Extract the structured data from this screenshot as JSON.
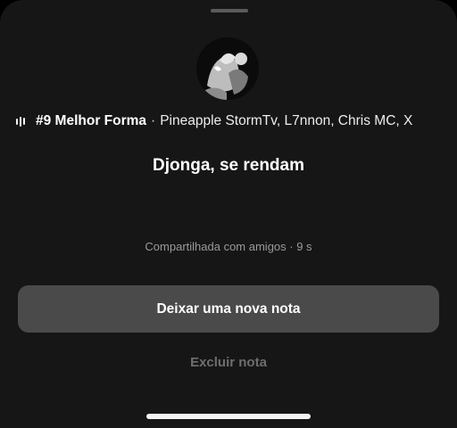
{
  "music": {
    "song": "#9 Melhor Forma",
    "separator": "·",
    "artists": "Pineapple StormTv, L7nnon, Chris MC, X"
  },
  "note": {
    "text": "Djonga, se rendam"
  },
  "meta": {
    "text": "Compartilhada com amigos · 9 s"
  },
  "actions": {
    "new_note": "Deixar uma nova nota",
    "delete_note": "Excluir nota"
  },
  "icons": {
    "playing": "audio-bars-icon",
    "avatar": "profile-photo"
  },
  "colors": {
    "background": "#161616",
    "primary_button": "#4a4a4a",
    "muted_text": "#9a9a9a",
    "disabled_text": "#6e6e6e"
  }
}
